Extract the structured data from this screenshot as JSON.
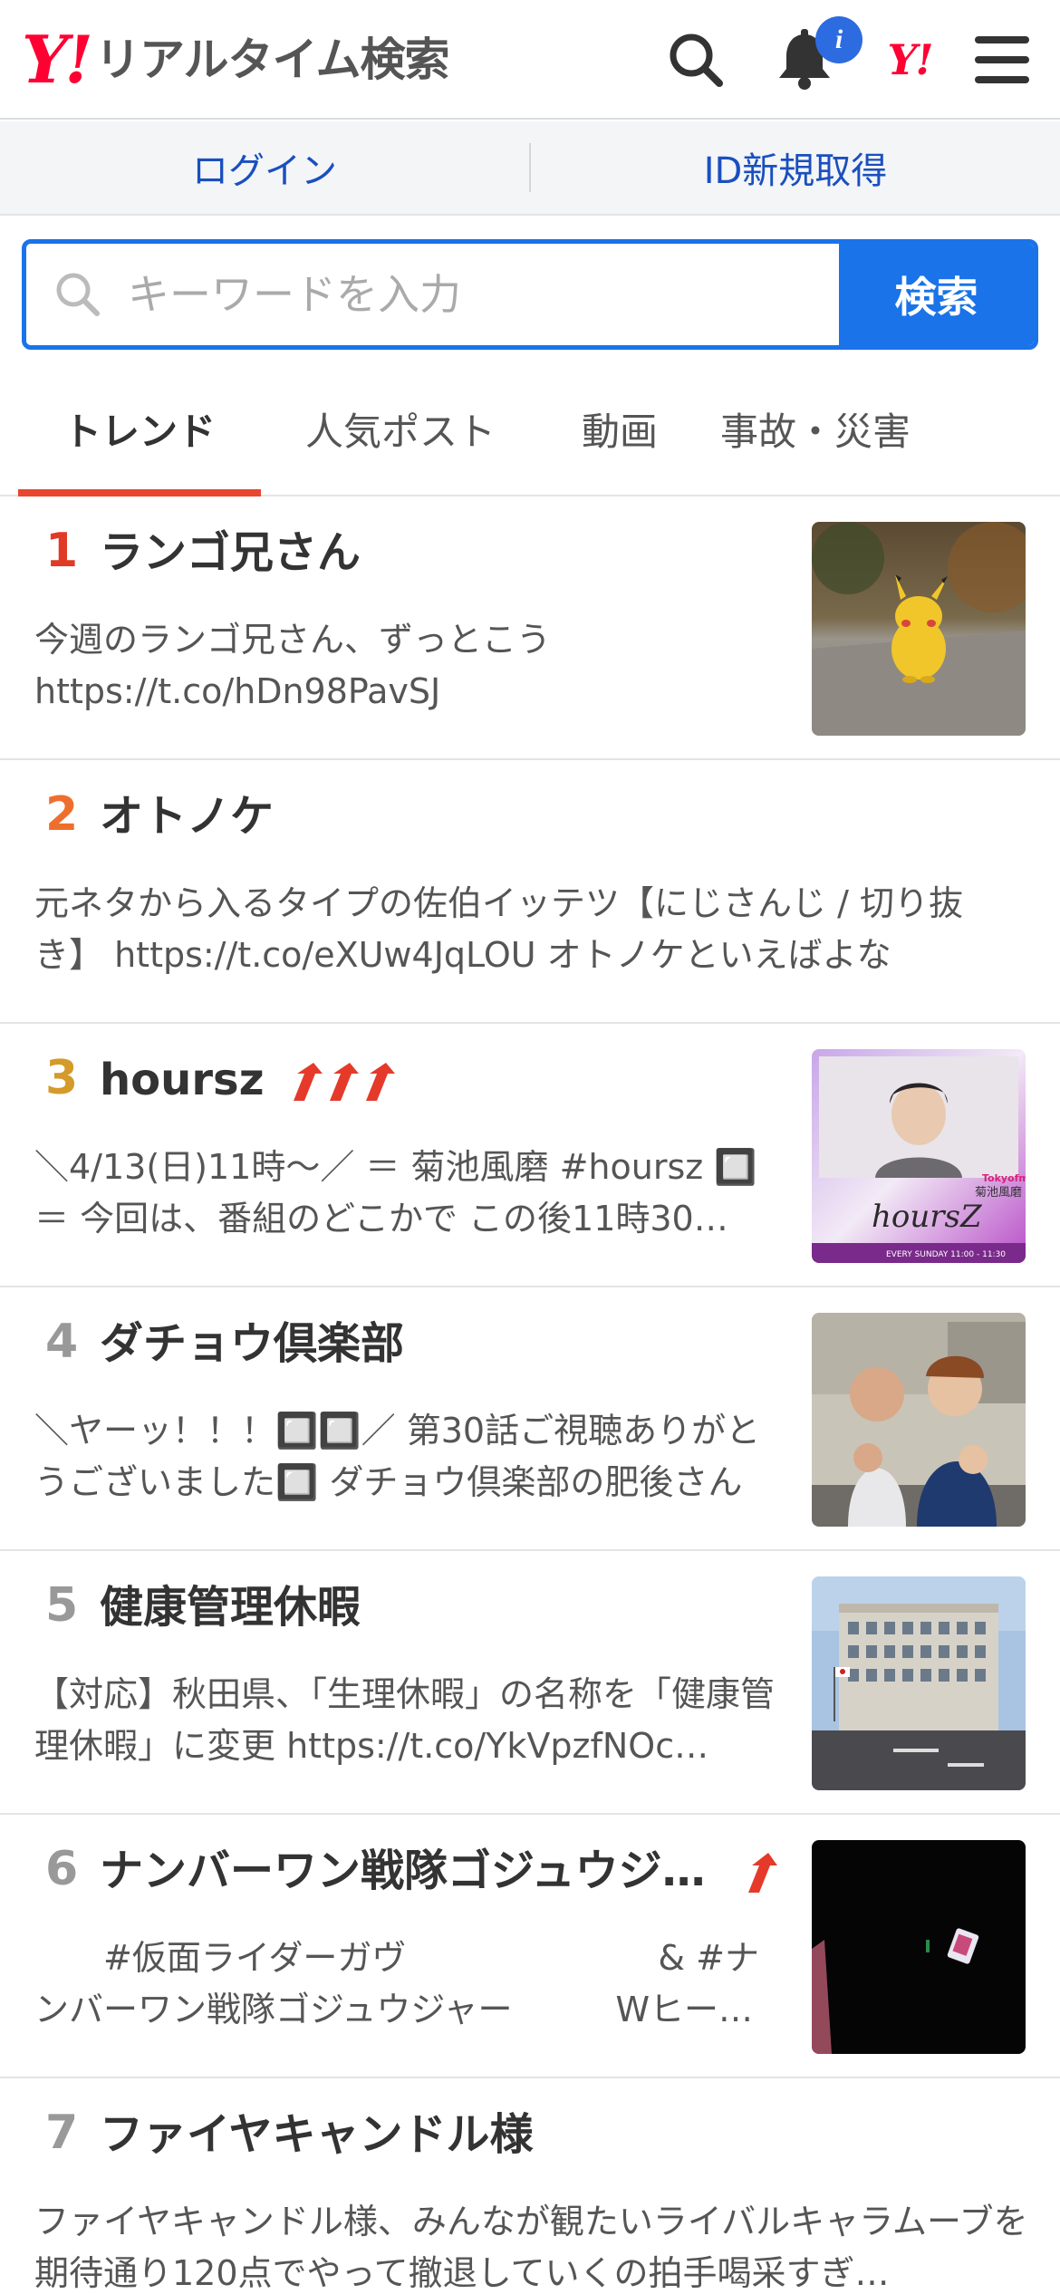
{
  "header": {
    "logo_mark": "Y!",
    "logo_text": "リアルタイム検索",
    "notification_badge": "i",
    "yj_mark": "Y!"
  },
  "auth": {
    "login_label": "ログイン",
    "signup_label": "ID新規取得"
  },
  "search": {
    "placeholder": "キーワードを入力",
    "button_label": "検索"
  },
  "tabs": [
    {
      "label": "トレンド",
      "active": true
    },
    {
      "label": "人気ポスト",
      "active": false
    },
    {
      "label": "動画",
      "active": false
    },
    {
      "label": "事故・災害",
      "active": false
    }
  ],
  "items": [
    {
      "rank": "1",
      "title": "ランゴ兄さん",
      "desc": "今週のランゴ兄さん、ずっとこう https://t.co/hDn98PavSJ",
      "rising": 0
    },
    {
      "rank": "2",
      "title": "オトノケ",
      "desc": "元ネタから入るタイプの佐伯イッテツ【にじさんじ / 切り抜き】 https://t.co/eXUw4JqLOU オトノケといえばよな",
      "rising": 0
    },
    {
      "rank": "3",
      "title": "hoursz",
      "desc": "＼4/13(日)11時〜／ ＝ 菊池風磨 #hoursz 🔲 ＝ 今回は、番組のどこかで この後11時30…",
      "rising": 3
    },
    {
      "rank": "4",
      "title": "ダチョウ倶楽部",
      "desc": "＼ヤーッ！！！🔲🔲／ 第30話ご視聴ありがとうございました🔲 ダチョウ倶楽部の肥後さんと…",
      "rising": 0
    },
    {
      "rank": "5",
      "title": "健康管理休暇",
      "desc": "【対応】秋田県、「生理休暇」の名称を「健康管理休暇」に変更 https://t.co/YkVpzfNOc…",
      "rising": 0
    },
    {
      "rank": "6",
      "title": "ナンバーワン戦隊ゴジュウジ…",
      "desc": "　　#仮面ライダーガヴ　　　　　　　 & #ナンバーワン戦隊ゴジュウジャー　　　Wヒー…",
      "rising": 1
    },
    {
      "rank": "7",
      "title": "ファイヤキャンドル様",
      "desc": "ファイヤキャンドル様、みんなが観たいライバルキャラムーブを期待通り120点でやって撤退していくの拍手喝采すぎ…",
      "rising": 0
    }
  ],
  "thumbs": {
    "hoursz_caption": "菊池風磨",
    "hoursz_logo": "hoursZ",
    "hoursz_station": "Tokyofm",
    "hoursz_schedule": "EVERY SUNDAY 11:00 - 11:30"
  },
  "colors": {
    "accent_blue": "#1a73e8",
    "tab_underline": "#e8472f",
    "rank1": "#e03a26",
    "rank2": "#ee6f2d",
    "rank3": "#d49a2a",
    "rank_other": "#999999",
    "rising_arrow": "#e53a2a"
  }
}
